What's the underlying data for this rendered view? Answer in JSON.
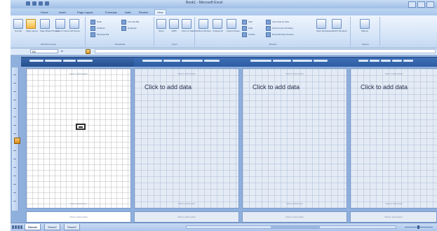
{
  "window": {
    "title": "Book1 - Microsoft Excel",
    "ribbon_tabs": [
      "Home",
      "Insert",
      "Page Layout",
      "Formulas",
      "Data",
      "Review",
      "View"
    ],
    "active_tab": "View"
  },
  "ribbon": {
    "groups": [
      "Workbook Views",
      "Show/Hide",
      "Zoom",
      "Window",
      "Macros"
    ],
    "view_buttons": [
      "Normal",
      "Page Layout",
      "Page Break Preview",
      "Custom Views",
      "Full Screen"
    ],
    "showhide_items": [
      "Ruler",
      "Gridlines",
      "Message Bar",
      "Formula Bar",
      "Headings"
    ],
    "zoom_buttons": [
      "Zoom",
      "100%",
      "Zoom to Selection"
    ],
    "window_buttons": [
      "New Window",
      "Arrange All",
      "Freeze Panes",
      "Split",
      "Hide",
      "Unhide",
      "View Side by Side",
      "Synchronous Scrolling",
      "Reset Window Position",
      "Save Workspace",
      "Switch Windows"
    ],
    "macro_button": "Macros"
  },
  "formula_bar": {
    "name_box": "B5",
    "fx_label": "fx"
  },
  "pages": {
    "placeholder": "Click to add data",
    "header_label": "Click to add header",
    "footer_label": "Click to add footer"
  },
  "sheets": [
    "Sheet1",
    "Sheet2",
    "Sheet3"
  ],
  "active_sheet": "Sheet1",
  "accent_colors": {
    "ribbon": "#d3e3f7",
    "page_area": "#8fb0dc",
    "column_header": "#2d5ca2",
    "active_button": "#f6b93f"
  }
}
